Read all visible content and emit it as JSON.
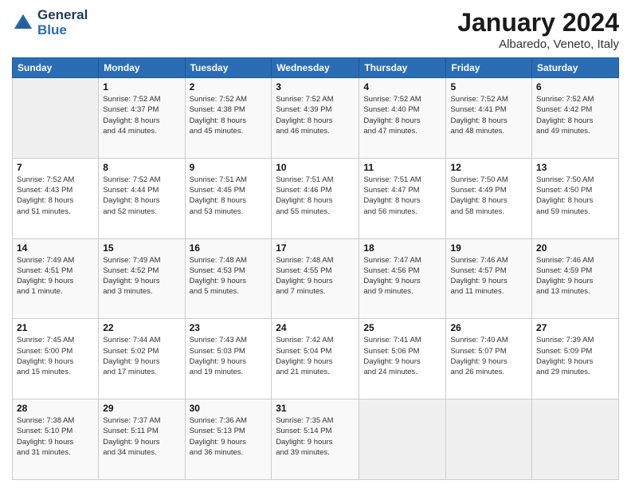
{
  "header": {
    "logo_line1": "General",
    "logo_line2": "Blue",
    "month": "January 2024",
    "location": "Albaredo, Veneto, Italy"
  },
  "weekdays": [
    "Sunday",
    "Monday",
    "Tuesday",
    "Wednesday",
    "Thursday",
    "Friday",
    "Saturday"
  ],
  "weeks": [
    [
      {
        "day": "",
        "info": ""
      },
      {
        "day": "1",
        "info": "Sunrise: 7:52 AM\nSunset: 4:37 PM\nDaylight: 8 hours\nand 44 minutes."
      },
      {
        "day": "2",
        "info": "Sunrise: 7:52 AM\nSunset: 4:38 PM\nDaylight: 8 hours\nand 45 minutes."
      },
      {
        "day": "3",
        "info": "Sunrise: 7:52 AM\nSunset: 4:39 PM\nDaylight: 8 hours\nand 46 minutes."
      },
      {
        "day": "4",
        "info": "Sunrise: 7:52 AM\nSunset: 4:40 PM\nDaylight: 8 hours\nand 47 minutes."
      },
      {
        "day": "5",
        "info": "Sunrise: 7:52 AM\nSunset: 4:41 PM\nDaylight: 8 hours\nand 48 minutes."
      },
      {
        "day": "6",
        "info": "Sunrise: 7:52 AM\nSunset: 4:42 PM\nDaylight: 8 hours\nand 49 minutes."
      }
    ],
    [
      {
        "day": "7",
        "info": "Sunrise: 7:52 AM\nSunset: 4:43 PM\nDaylight: 8 hours\nand 51 minutes."
      },
      {
        "day": "8",
        "info": "Sunrise: 7:52 AM\nSunset: 4:44 PM\nDaylight: 8 hours\nand 52 minutes."
      },
      {
        "day": "9",
        "info": "Sunrise: 7:51 AM\nSunset: 4:45 PM\nDaylight: 8 hours\nand 53 minutes."
      },
      {
        "day": "10",
        "info": "Sunrise: 7:51 AM\nSunset: 4:46 PM\nDaylight: 8 hours\nand 55 minutes."
      },
      {
        "day": "11",
        "info": "Sunrise: 7:51 AM\nSunset: 4:47 PM\nDaylight: 8 hours\nand 56 minutes."
      },
      {
        "day": "12",
        "info": "Sunrise: 7:50 AM\nSunset: 4:49 PM\nDaylight: 8 hours\nand 58 minutes."
      },
      {
        "day": "13",
        "info": "Sunrise: 7:50 AM\nSunset: 4:50 PM\nDaylight: 8 hours\nand 59 minutes."
      }
    ],
    [
      {
        "day": "14",
        "info": "Sunrise: 7:49 AM\nSunset: 4:51 PM\nDaylight: 9 hours\nand 1 minute."
      },
      {
        "day": "15",
        "info": "Sunrise: 7:49 AM\nSunset: 4:52 PM\nDaylight: 9 hours\nand 3 minutes."
      },
      {
        "day": "16",
        "info": "Sunrise: 7:48 AM\nSunset: 4:53 PM\nDaylight: 9 hours\nand 5 minutes."
      },
      {
        "day": "17",
        "info": "Sunrise: 7:48 AM\nSunset: 4:55 PM\nDaylight: 9 hours\nand 7 minutes."
      },
      {
        "day": "18",
        "info": "Sunrise: 7:47 AM\nSunset: 4:56 PM\nDaylight: 9 hours\nand 9 minutes."
      },
      {
        "day": "19",
        "info": "Sunrise: 7:46 AM\nSunset: 4:57 PM\nDaylight: 9 hours\nand 11 minutes."
      },
      {
        "day": "20",
        "info": "Sunrise: 7:46 AM\nSunset: 4:59 PM\nDaylight: 9 hours\nand 13 minutes."
      }
    ],
    [
      {
        "day": "21",
        "info": "Sunrise: 7:45 AM\nSunset: 5:00 PM\nDaylight: 9 hours\nand 15 minutes."
      },
      {
        "day": "22",
        "info": "Sunrise: 7:44 AM\nSunset: 5:02 PM\nDaylight: 9 hours\nand 17 minutes."
      },
      {
        "day": "23",
        "info": "Sunrise: 7:43 AM\nSunset: 5:03 PM\nDaylight: 9 hours\nand 19 minutes."
      },
      {
        "day": "24",
        "info": "Sunrise: 7:42 AM\nSunset: 5:04 PM\nDaylight: 9 hours\nand 21 minutes."
      },
      {
        "day": "25",
        "info": "Sunrise: 7:41 AM\nSunset: 5:06 PM\nDaylight: 9 hours\nand 24 minutes."
      },
      {
        "day": "26",
        "info": "Sunrise: 7:40 AM\nSunset: 5:07 PM\nDaylight: 9 hours\nand 26 minutes."
      },
      {
        "day": "27",
        "info": "Sunrise: 7:39 AM\nSunset: 5:09 PM\nDaylight: 9 hours\nand 29 minutes."
      }
    ],
    [
      {
        "day": "28",
        "info": "Sunrise: 7:38 AM\nSunset: 5:10 PM\nDaylight: 9 hours\nand 31 minutes."
      },
      {
        "day": "29",
        "info": "Sunrise: 7:37 AM\nSunset: 5:11 PM\nDaylight: 9 hours\nand 34 minutes."
      },
      {
        "day": "30",
        "info": "Sunrise: 7:36 AM\nSunset: 5:13 PM\nDaylight: 9 hours\nand 36 minutes."
      },
      {
        "day": "31",
        "info": "Sunrise: 7:35 AM\nSunset: 5:14 PM\nDaylight: 9 hours\nand 39 minutes."
      },
      {
        "day": "",
        "info": ""
      },
      {
        "day": "",
        "info": ""
      },
      {
        "day": "",
        "info": ""
      }
    ]
  ]
}
